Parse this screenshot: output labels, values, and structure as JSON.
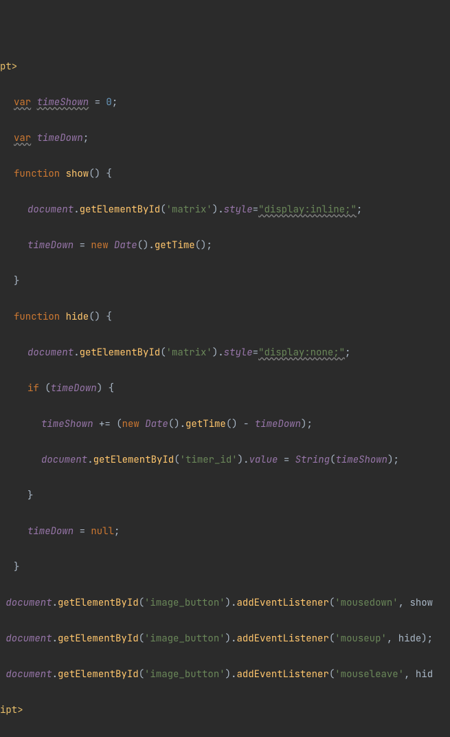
{
  "code": {
    "tagOpen": "pt>",
    "tagClose": "ipt>",
    "var": "var",
    "func": "function",
    "newkw": "new",
    "ifkw": "if",
    "nullkw": "null",
    "timeShown": "timeShown",
    "timeDown": "timeDown",
    "zero": "0",
    "show": "show",
    "hide": "hide",
    "document": "document",
    "getElementById": "getElementById",
    "addEventListener": "addEventListener",
    "style": "style",
    "value": "value",
    "getTime": "getTime",
    "Date": "Date",
    "String": "String",
    "matrix": "'matrix'",
    "timerId": "'timer_id'",
    "imageButton": "'image_button'",
    "mousedown": "'mousedown'",
    "mouseup": "'mouseup'",
    "mouseleave": "'mouseleave'",
    "dispInline": "\"display:inline;\"",
    "dispNone": "\"display:none;\""
  }
}
